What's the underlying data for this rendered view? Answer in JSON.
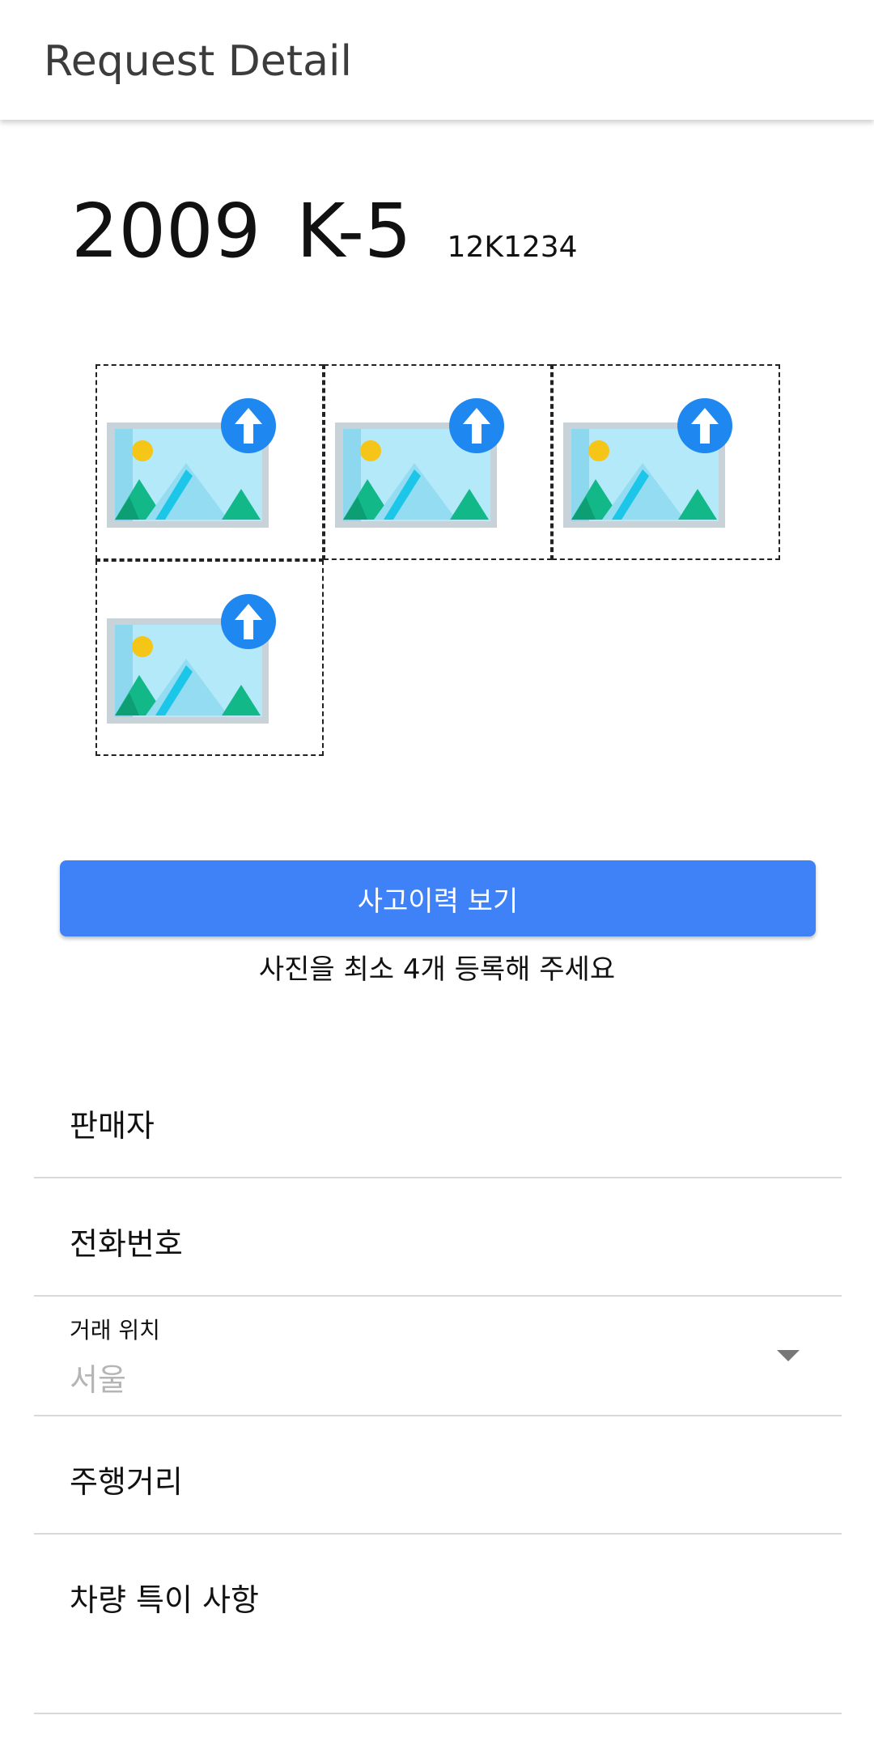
{
  "appbar": {
    "title": "Request Detail"
  },
  "vehicle": {
    "year": "2009",
    "model": "K-5",
    "plate": "12K1234"
  },
  "photos": {
    "slot_count": 4,
    "icon": "image-upload-icon"
  },
  "actions": {
    "history_button_label": "사고이력 보기",
    "photo_hint": "사진을 최소 4개 등록해 주세요"
  },
  "form": {
    "seller_label": "판매자",
    "phone_label": "전화번호",
    "location_label": "거래 위치",
    "location_value": "서울",
    "mileage_label": "주행거리",
    "notes_label": "차량 특이 사항"
  },
  "colors": {
    "primary": "#3f82f7",
    "upload_badge": "#1e88f0",
    "divider": "#d9d9d9",
    "placeholder": "#b5b5b5"
  }
}
